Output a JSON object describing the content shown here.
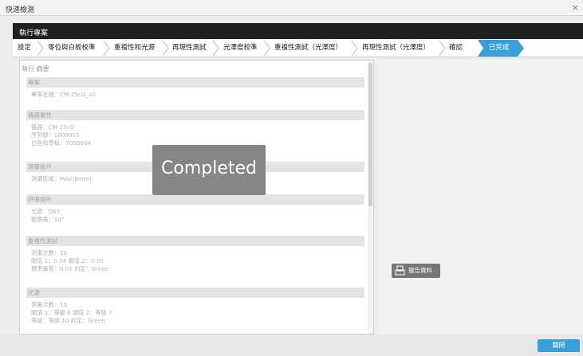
{
  "window": {
    "title": "快速檢測",
    "close_glyph": "×"
  },
  "project_header": "執行專案",
  "steps": [
    "設定",
    "零位與白板校準",
    "重複性和光源",
    "再現性測試",
    "光澤度校準",
    "重複性測試（光澤度）",
    "再現性測試（光澤度）",
    "確認"
  ],
  "active_step": "已完成",
  "summary": {
    "title": "執行 摘要",
    "sections": [
      {
        "head": "專案",
        "lines": [
          "專案名稱：CM-25cG_All"
        ]
      },
      {
        "head": "儀器屬性",
        "lines": [
          "儀器：CM-25cG",
          "序列號：1000005",
          "白色校準板：7000004"
        ]
      },
      {
        "head": "測量條件",
        "lines": [
          "測量區域：MAV(8mm)"
        ]
      },
      {
        "head": "評價條件",
        "lines": [
          "光源：D65",
          "觀察角：10°"
        ]
      },
      {
        "head": "重複性測試",
        "lines": [
          "測量次數：10",
          "閾值 1：0.08  閾值 2：0.05",
          "標準偏差：0.01  判定：Green"
        ]
      },
      {
        "head": "光源",
        "lines": [
          "測量次數：10",
          "閾值 1：等級 6  閾值 2：等級 7",
          "等級：等級 10  判定：Green"
        ]
      }
    ]
  },
  "overlay_text": "Completed",
  "report_button": "報告資料",
  "close_button": "關閉",
  "colors": {
    "accent": "#3a9ed8",
    "dark_header": "#1f1f1f"
  }
}
